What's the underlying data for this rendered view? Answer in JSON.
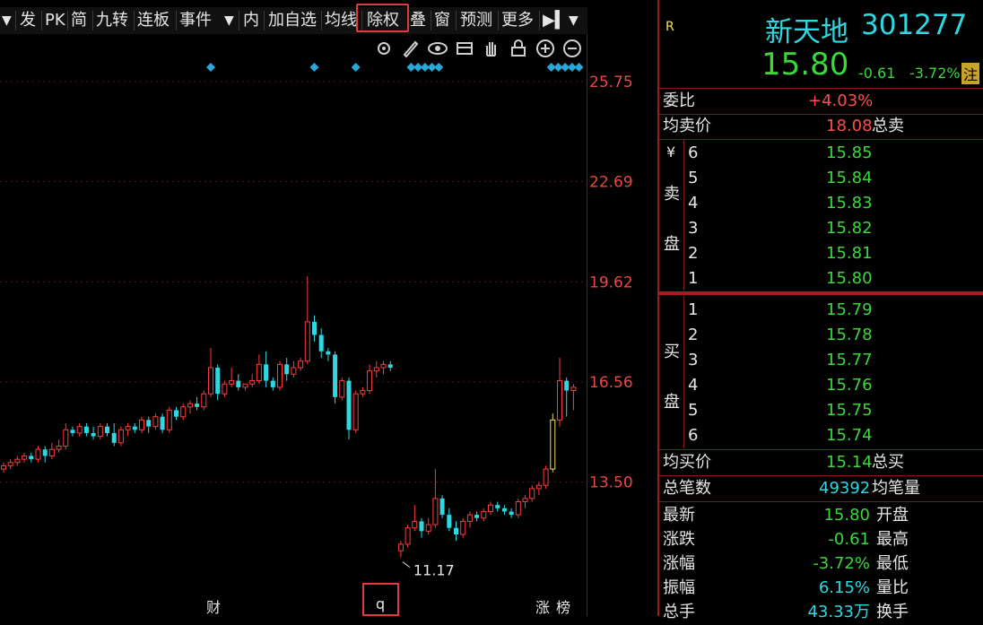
{
  "toolbar": {
    "items": [
      "发",
      "PK",
      "简",
      "九转",
      "连板",
      "事件",
      "内",
      "加自选",
      "均线",
      "除权",
      "叠",
      "窗",
      "预测",
      "更多"
    ]
  },
  "chart_data": {
    "type": "candlestick",
    "y_ticks": [
      "25.75",
      "22.69",
      "19.62",
      "16.56",
      "13.50"
    ],
    "ylim": [
      10.2,
      27.2
    ],
    "low_marker": "11.17",
    "bottom_tags": [
      "财",
      "q",
      "涨",
      "榜"
    ],
    "colors": {
      "up": "#ff3b3b",
      "down": "#2fd7e0",
      "highlight": "#f0e060",
      "marker": "#2aa7d8"
    },
    "candles": [
      [
        13.9,
        14.1,
        13.8,
        14.0
      ],
      [
        14.0,
        14.2,
        13.9,
        14.1
      ],
      [
        14.1,
        14.3,
        14.0,
        14.2
      ],
      [
        14.2,
        14.4,
        14.1,
        14.3
      ],
      [
        14.3,
        14.4,
        14.1,
        14.2
      ],
      [
        14.2,
        14.6,
        14.1,
        14.5
      ],
      [
        14.5,
        14.6,
        14.1,
        14.3
      ],
      [
        14.3,
        14.7,
        14.2,
        14.5
      ],
      [
        14.5,
        14.8,
        14.4,
        14.6
      ],
      [
        14.6,
        15.3,
        14.5,
        15.1
      ],
      [
        15.1,
        15.2,
        14.9,
        15.0
      ],
      [
        15.0,
        15.3,
        14.9,
        15.2
      ],
      [
        15.2,
        15.3,
        14.9,
        15.0
      ],
      [
        15.0,
        15.2,
        14.8,
        14.9
      ],
      [
        14.9,
        15.3,
        14.8,
        15.2
      ],
      [
        15.2,
        15.3,
        14.9,
        15.0
      ],
      [
        15.0,
        15.3,
        14.6,
        14.7
      ],
      [
        14.7,
        15.2,
        14.6,
        15.1
      ],
      [
        15.1,
        15.3,
        14.9,
        15.2
      ],
      [
        15.2,
        15.3,
        15.0,
        15.1
      ],
      [
        15.1,
        15.5,
        15.0,
        15.4
      ],
      [
        15.4,
        15.5,
        15.0,
        15.2
      ],
      [
        15.2,
        15.6,
        15.1,
        15.5
      ],
      [
        15.5,
        15.6,
        15.0,
        15.1
      ],
      [
        15.1,
        15.8,
        15.0,
        15.7
      ],
      [
        15.7,
        15.8,
        15.4,
        15.5
      ],
      [
        15.5,
        15.9,
        15.4,
        15.8
      ],
      [
        15.8,
        16.0,
        15.6,
        15.9
      ],
      [
        15.9,
        16.1,
        15.7,
        15.8
      ],
      [
        15.8,
        16.3,
        15.7,
        16.2
      ],
      [
        16.2,
        17.6,
        16.1,
        17.0
      ],
      [
        17.0,
        17.1,
        16.0,
        16.2
      ],
      [
        16.2,
        16.6,
        16.1,
        16.5
      ],
      [
        16.5,
        17.0,
        16.4,
        16.6
      ],
      [
        16.6,
        16.8,
        16.3,
        16.4
      ],
      [
        16.4,
        16.5,
        16.3,
        16.5
      ],
      [
        16.5,
        16.8,
        16.4,
        16.6
      ],
      [
        16.6,
        17.4,
        16.5,
        17.1
      ],
      [
        17.1,
        17.5,
        16.4,
        16.6
      ],
      [
        16.6,
        16.7,
        16.3,
        16.4
      ],
      [
        16.4,
        17.2,
        16.3,
        17.1
      ],
      [
        17.1,
        17.3,
        16.6,
        16.8
      ],
      [
        16.8,
        17.2,
        16.7,
        17.0
      ],
      [
        17.0,
        17.3,
        16.9,
        17.2
      ],
      [
        17.2,
        19.8,
        17.1,
        18.4
      ],
      [
        18.4,
        18.6,
        17.8,
        18.0
      ],
      [
        18.0,
        18.2,
        17.3,
        17.5
      ],
      [
        17.5,
        17.6,
        17.2,
        17.4
      ],
      [
        17.4,
        17.5,
        15.9,
        16.1
      ],
      [
        16.1,
        16.7,
        16.0,
        16.6
      ],
      [
        16.6,
        16.7,
        14.8,
        15.1
      ],
      [
        15.1,
        16.3,
        15.0,
        16.2
      ],
      [
        16.2,
        16.4,
        16.1,
        16.3
      ],
      [
        16.3,
        17.1,
        16.2,
        16.9
      ],
      [
        16.9,
        17.2,
        16.7,
        17.0
      ],
      [
        17.0,
        17.2,
        16.8,
        17.1
      ],
      [
        17.1,
        17.2,
        16.9,
        17.0
      ],
      [
        11.4,
        11.7,
        11.2,
        11.6
      ],
      [
        11.6,
        12.2,
        11.5,
        12.1
      ],
      [
        12.1,
        12.8,
        12.0,
        12.3
      ],
      [
        12.3,
        12.4,
        11.8,
        12.0
      ],
      [
        12.0,
        12.4,
        11.9,
        12.2
      ],
      [
        12.2,
        13.9,
        12.1,
        13.0
      ],
      [
        13.0,
        13.1,
        12.4,
        12.5
      ],
      [
        12.5,
        12.7,
        12.0,
        12.1
      ],
      [
        12.1,
        12.3,
        11.7,
        11.9
      ],
      [
        11.9,
        12.4,
        11.8,
        12.3
      ],
      [
        12.3,
        12.6,
        12.1,
        12.5
      ],
      [
        12.5,
        12.6,
        12.3,
        12.4
      ],
      [
        12.4,
        12.7,
        12.3,
        12.6
      ],
      [
        12.6,
        12.9,
        12.5,
        12.8
      ],
      [
        12.8,
        12.9,
        12.6,
        12.7
      ],
      [
        12.7,
        12.8,
        12.5,
        12.6
      ],
      [
        12.6,
        12.7,
        12.4,
        12.5
      ],
      [
        12.5,
        13.0,
        12.4,
        12.9
      ],
      [
        12.9,
        13.1,
        12.7,
        13.0
      ],
      [
        13.0,
        13.4,
        12.9,
        13.3
      ],
      [
        13.3,
        13.5,
        13.1,
        13.4
      ],
      [
        13.4,
        14.0,
        13.3,
        13.9
      ],
      [
        13.9,
        15.6,
        13.8,
        15.4
      ],
      [
        15.4,
        17.3,
        15.2,
        16.6
      ],
      [
        16.6,
        16.7,
        15.5,
        16.3
      ],
      [
        16.3,
        16.5,
        15.7,
        16.4
      ]
    ]
  },
  "stock": {
    "code_marker": "R",
    "name": "新天地",
    "code": "301277",
    "price": "15.80",
    "change": "-0.61",
    "change_pct": "-3.72%",
    "badge": "注"
  },
  "panel": {
    "weibi_label": "委比",
    "weibi_value": "+4.03%",
    "avg_sell_label": "均卖价",
    "avg_sell_value": "18.08",
    "total_sell_label": "总卖",
    "yen": "¥",
    "sell_side": [
      "卖",
      "盘"
    ],
    "sell_levels": [
      {
        "n": "6",
        "p": "15.85"
      },
      {
        "n": "5",
        "p": "15.84"
      },
      {
        "n": "4",
        "p": "15.83"
      },
      {
        "n": "3",
        "p": "15.82"
      },
      {
        "n": "2",
        "p": "15.81"
      },
      {
        "n": "1",
        "p": "15.80"
      }
    ],
    "buy_side": [
      "买",
      "盘"
    ],
    "buy_levels": [
      {
        "n": "1",
        "p": "15.79"
      },
      {
        "n": "2",
        "p": "15.78"
      },
      {
        "n": "3",
        "p": "15.77"
      },
      {
        "n": "4",
        "p": "15.76"
      },
      {
        "n": "5",
        "p": "15.75"
      },
      {
        "n": "6",
        "p": "15.74"
      }
    ],
    "avg_buy_label": "均买价",
    "avg_buy_value": "15.14",
    "total_buy_label": "总买",
    "total_trades_label": "总笔数",
    "total_trades_value": "49392",
    "avg_trade_label": "均笔量",
    "stats": [
      {
        "label": "最新",
        "value": "15.80",
        "right": "开盘"
      },
      {
        "label": "涨跌",
        "value": "-0.61",
        "right": "最高"
      },
      {
        "label": "涨幅",
        "value": "-3.72%",
        "right": "最低"
      },
      {
        "label": "振幅",
        "value": "6.15%",
        "right": "量比"
      },
      {
        "label": "总手",
        "value": "43.33万",
        "right": "换手"
      }
    ]
  }
}
